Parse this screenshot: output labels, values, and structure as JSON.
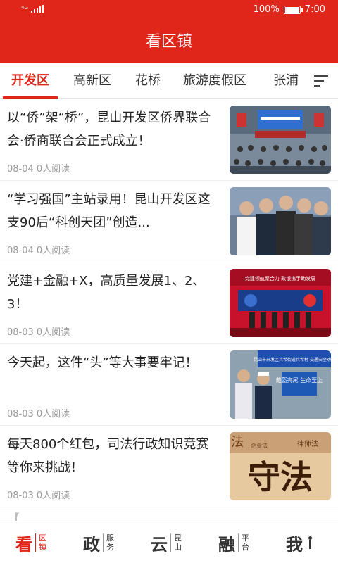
{
  "status": {
    "network": "4G",
    "battery": "100%",
    "time": "7:00"
  },
  "header": {
    "title": "看区镇"
  },
  "tabs": [
    "开发区",
    "高新区",
    "花桥",
    "旅游度假区",
    "张浦"
  ],
  "articles": [
    {
      "title": "以“侨”架“桥”，昆山开发区侨界联合会·侨商联合会正式成立！",
      "date": "08-04",
      "reads": "0人阅读"
    },
    {
      "title": "“学习强国”主站录用！昆山开发区这支90后“科创天团”创造...",
      "date": "08-04",
      "reads": "0人阅读"
    },
    {
      "title": "党建+金融+X，高质量发展1、2、3！",
      "date": "08-03",
      "reads": "0人阅读",
      "banner": "党建领航聚合力 政银携手助发展"
    },
    {
      "title": "今天起，这件“头”等大事要牢记！",
      "date": "08-03",
      "reads": "0人阅读",
      "banner": "昆山市开发区兵希街道兵希村 交通安全劝导",
      "sign": "戴盔亮尾 生命至上"
    },
    {
      "title": "每天800个红包，司法行政知识竞赛等你来挑战！",
      "date": "08-03",
      "reads": "0人阅读",
      "big": "守法",
      "corner": "法",
      "small1": "律师法",
      "small2": "企业法"
    }
  ],
  "partial_title": "【",
  "bottom_nav": [
    {
      "big": "看",
      "small": "区镇"
    },
    {
      "big": "政",
      "small": "服务"
    },
    {
      "big": "云",
      "small": "昆山"
    },
    {
      "big": "融",
      "small": "平台"
    },
    {
      "big": "我",
      "small": ""
    }
  ],
  "colors": {
    "brand": "#e0251b",
    "meta": "#999999"
  }
}
